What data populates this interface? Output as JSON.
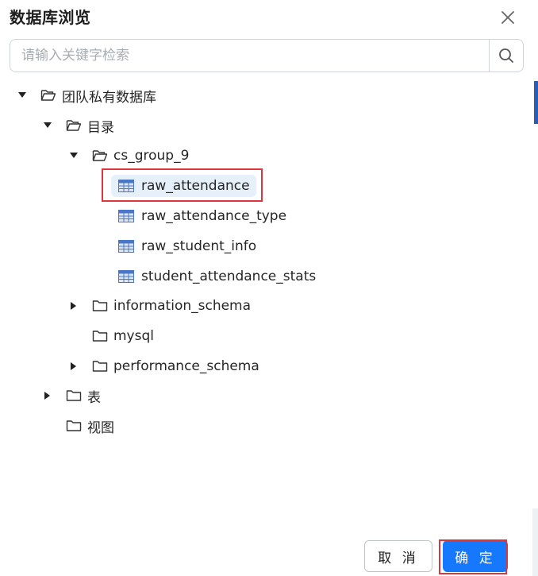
{
  "dialog": {
    "title": "数据库浏览",
    "search_placeholder": "请输入关键字检索",
    "cancel_label": "取 消",
    "confirm_label": "确 定"
  },
  "tree": {
    "root": "团队私有数据库",
    "catalog": "目录",
    "group": "cs_group_9",
    "tables": [
      "raw_attendance",
      "raw_attendance_type",
      "raw_student_info",
      "student_attendance_stats"
    ],
    "schema_info": "information_schema",
    "schema_mysql": "mysql",
    "schema_perf": "performance_schema",
    "tables_folder": "表",
    "views_folder": "视图"
  },
  "colors": {
    "accent": "#1677ff",
    "highlight": "#d9363e",
    "table_icon": "#4a76c8",
    "selected_bg": "#e6f0fb"
  }
}
